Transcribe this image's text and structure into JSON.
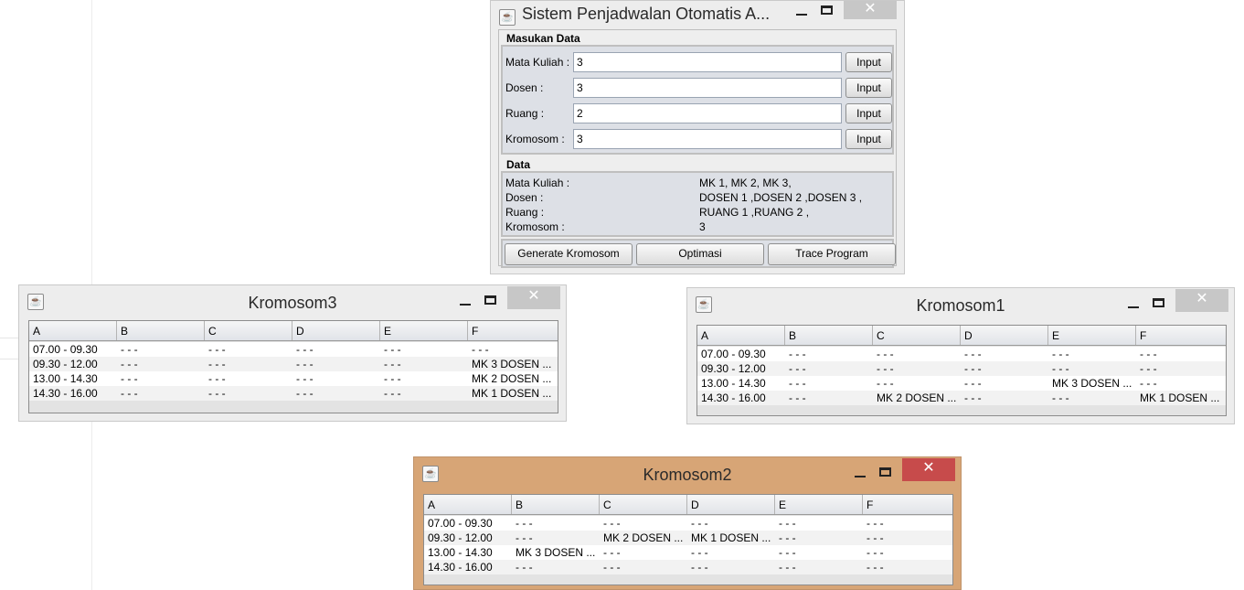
{
  "main_window": {
    "title": "Sistem Penjadwalan Otomatis A...",
    "section_input": "Masukan Data",
    "fields": [
      {
        "label": "Mata Kuliah :",
        "value": "3",
        "button": "Input"
      },
      {
        "label": "Dosen :",
        "value": "3",
        "button": "Input"
      },
      {
        "label": "Ruang :",
        "value": "2",
        "button": "Input"
      },
      {
        "label": "Kromosom :",
        "value": "3",
        "button": "Input"
      }
    ],
    "section_data": "Data",
    "data_rows": [
      {
        "label": "Mata Kuliah :",
        "value": "MK 1, MK 2, MK 3,"
      },
      {
        "label": "Dosen :",
        "value": "DOSEN 1 ,DOSEN 2 ,DOSEN 3 ,"
      },
      {
        "label": "Ruang :",
        "value": "RUANG 1 ,RUANG 2 ,"
      },
      {
        "label": "Kromosom :",
        "value": "3"
      }
    ],
    "buttons": [
      "Generate Kromosom",
      "Optimasi",
      "Trace Program"
    ]
  },
  "window_controls": {
    "close": "✕"
  },
  "kromosom3": {
    "title": "Kromosom3",
    "columns": [
      "A",
      "B",
      "C",
      "D",
      "E",
      "F"
    ],
    "rows": [
      [
        "07.00 - 09.30",
        "- - -",
        "- - -",
        "- - -",
        "- - -",
        "- - -"
      ],
      [
        "09.30 - 12.00",
        "- - -",
        "- - -",
        "- - -",
        "- - -",
        "MK 3 DOSEN ..."
      ],
      [
        "13.00 - 14.30",
        "- - -",
        "- - -",
        "- - -",
        "- - -",
        "MK 2 DOSEN ..."
      ],
      [
        "14.30 - 16.00",
        "- - -",
        "- - -",
        "- - -",
        "- - -",
        "MK 1 DOSEN ..."
      ]
    ]
  },
  "kromosom1": {
    "title": "Kromosom1",
    "columns": [
      "A",
      "B",
      "C",
      "D",
      "E",
      "F"
    ],
    "rows": [
      [
        "07.00 - 09.30",
        "- - -",
        "- - -",
        "- - -",
        "- - -",
        "- - -"
      ],
      [
        "09.30 - 12.00",
        "- - -",
        "- - -",
        "- - -",
        "- - -",
        "- - -"
      ],
      [
        "13.00 - 14.30",
        "- - -",
        "- - -",
        "- - -",
        "MK 3 DOSEN ...",
        "- - -"
      ],
      [
        "14.30 - 16.00",
        "- - -",
        "MK 2 DOSEN ...",
        "- - -",
        "- - -",
        "MK 1 DOSEN ..."
      ]
    ]
  },
  "kromosom2": {
    "title": "Kromosom2",
    "columns": [
      "A",
      "B",
      "C",
      "D",
      "E",
      "F"
    ],
    "rows": [
      [
        "07.00 - 09.30",
        "- - -",
        "- - -",
        "- - -",
        "- - -",
        "- - -"
      ],
      [
        "09.30 - 12.00",
        "- - -",
        "MK 2 DOSEN ...",
        "MK 1 DOSEN ...",
        "- - -",
        "- - -"
      ],
      [
        "13.00 - 14.30",
        "MK 3 DOSEN ...",
        "- - -",
        "- - -",
        "- - -",
        "- - -"
      ],
      [
        "14.30 - 16.00",
        "- - -",
        "- - -",
        "- - -",
        "- - -",
        "- - -"
      ]
    ]
  },
  "colors": {
    "active_frame": "#d7a576",
    "close_active": "#c74b4b",
    "panel": "#dde0e6"
  }
}
